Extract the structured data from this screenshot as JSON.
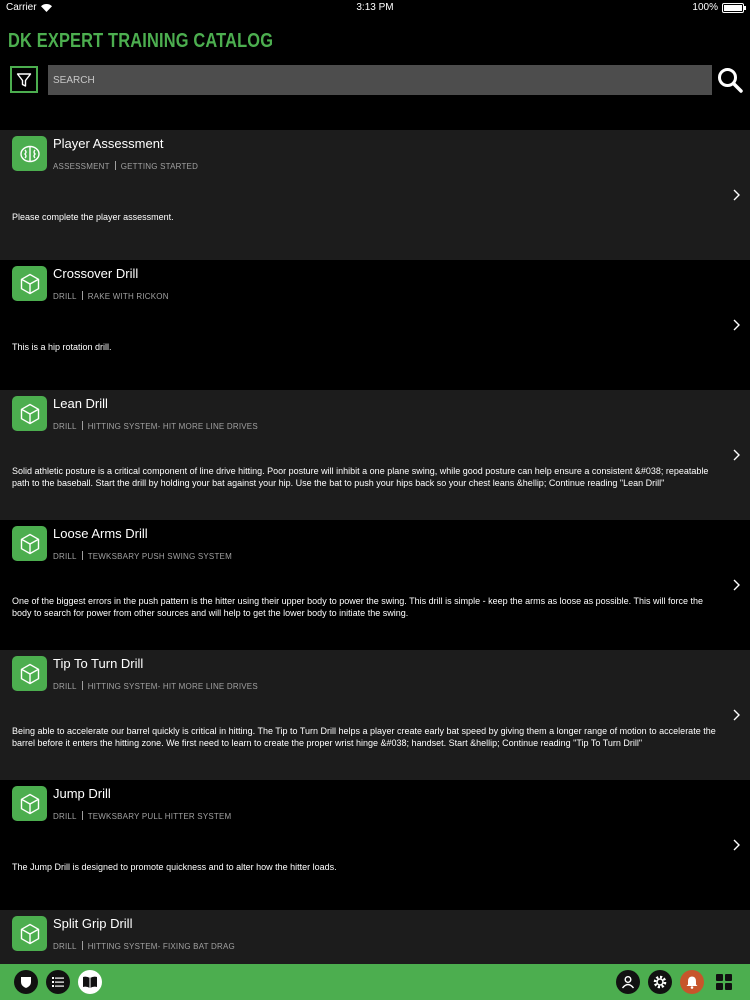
{
  "status_bar": {
    "carrier": "Carrier",
    "time": "3:13 PM",
    "battery": "100%"
  },
  "header": {
    "title": "DK EXPERT TRAINING CATALOG"
  },
  "search": {
    "placeholder": "SEARCH",
    "value": ""
  },
  "items": [
    {
      "icon": "brain-icon",
      "title": "Player Assessment",
      "category": "ASSESSMENT",
      "program": "GETTING STARTED",
      "description": "Please complete the player assessment."
    },
    {
      "icon": "cube-icon",
      "title": "Crossover Drill",
      "category": "DRILL",
      "program": "RAKE WITH RICKON",
      "description": "This is a hip rotation drill."
    },
    {
      "icon": "cube-icon",
      "title": "Lean Drill",
      "category": "DRILL",
      "program": "HITTING SYSTEM- HIT MORE LINE DRIVES",
      "description": "Solid athletic posture is a critical component of line drive hitting. Poor posture will inhibit a one plane swing, while good posture can help ensure a consistent &#038; repeatable path to the baseball. Start the drill by holding your bat against your hip. Use the bat to push your hips back so your chest leans &hellip; Continue reading \"Lean Drill\""
    },
    {
      "icon": "cube-icon",
      "title": "Loose Arms Drill",
      "category": "DRILL",
      "program": "TEWKSBARY PUSH SWING SYSTEM",
      "description": "One of the biggest errors in the push pattern is the hitter using their upper body to power the swing. This drill is simple - keep the arms as loose as possible. This will force the body to search for power from other sources and will help to get the lower body to initiate the swing."
    },
    {
      "icon": "cube-icon",
      "title": "Tip To Turn Drill",
      "category": "DRILL",
      "program": "HITTING SYSTEM- HIT MORE LINE DRIVES",
      "description": "Being able to accelerate our barrel quickly is critical in hitting. The Tip to Turn Drill helps a player create early bat speed by giving them a longer range of motion to accelerate the barrel before it enters the hitting zone. We first need to learn to create the proper wrist hinge &#038; handset. Start &hellip; Continue reading \"Tip To Turn Drill\""
    },
    {
      "icon": "cube-icon",
      "title": "Jump Drill",
      "category": "DRILL",
      "program": "TEWKSBARY PULL HITTER SYSTEM",
      "description": "The Jump Drill is designed to promote quickness and to alter how the hitter loads."
    },
    {
      "icon": "cube-icon",
      "title": "Split Grip Drill",
      "category": "DRILL",
      "program": "HITTING SYSTEM- FIXING BAT DRAG",
      "description": ""
    }
  ],
  "tab_bar": {
    "left": [
      "shield-icon",
      "list-icon",
      "book-icon"
    ],
    "right": [
      "user-icon",
      "gear-icon",
      "bell-icon",
      "grid-icon"
    ]
  },
  "colors": {
    "accent": "#4cae4f",
    "row_alt": "#1c1c1c",
    "search_bg": "#4d4d4d",
    "bell": "#c7552b"
  }
}
